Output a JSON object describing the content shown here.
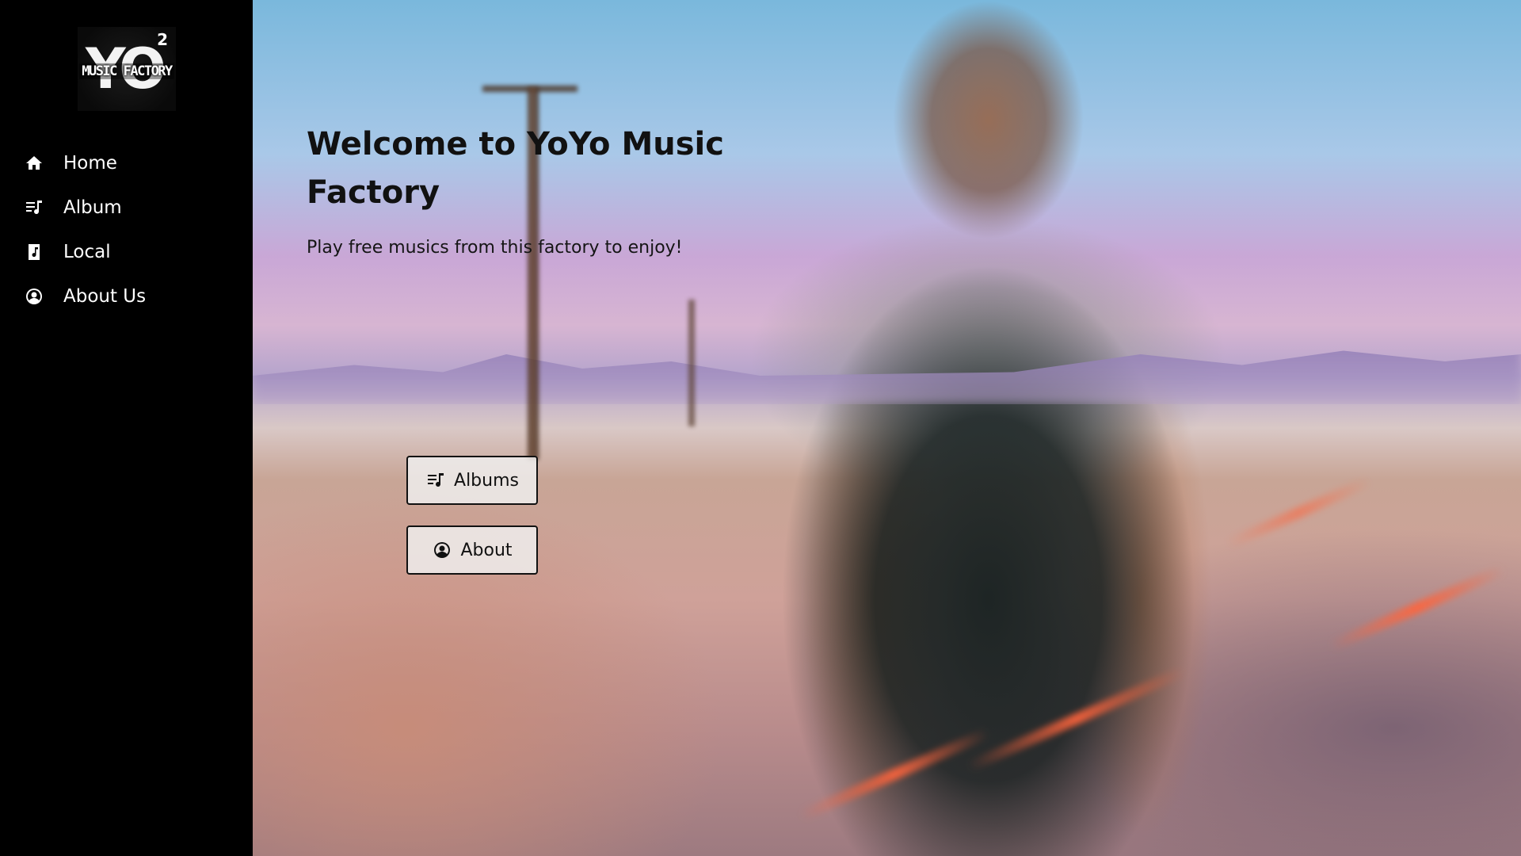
{
  "sidebar": {
    "logo": {
      "text": "MUSIC FACTORY",
      "mark": "YO",
      "superscript": "2"
    },
    "items": [
      {
        "label": "Home",
        "icon": "home-icon"
      },
      {
        "label": "Album",
        "icon": "playlist-music-icon"
      },
      {
        "label": "Local",
        "icon": "music-file-icon"
      },
      {
        "label": "About Us",
        "icon": "user-circle-icon"
      }
    ]
  },
  "hero": {
    "title": "Welcome to YoYo Music Factory",
    "subtitle": "Play free musics from this factory to enjoy!",
    "buttons": [
      {
        "label": "Albums",
        "icon": "playlist-music-icon"
      },
      {
        "label": "About",
        "icon": "user-circle-icon"
      }
    ]
  }
}
